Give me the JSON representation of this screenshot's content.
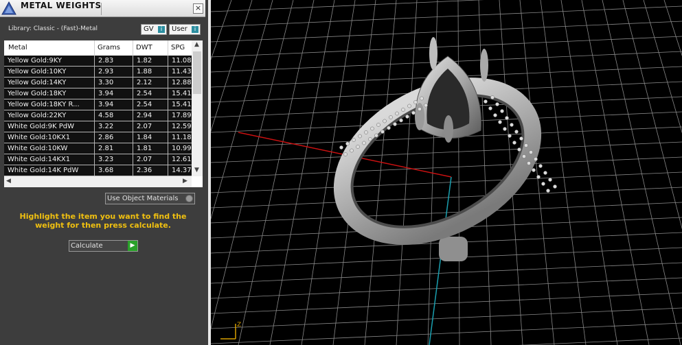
{
  "panel": {
    "title": "METAL WEIGHTS",
    "close_label": "×",
    "library_label": "Library: Classic - (Fast)-Metal",
    "gv_label": "GV",
    "user_label": "User",
    "use_object_materials_label": "Use Object Materials",
    "hint_text": "Highlight the item you want to find the weight for then press calculate.",
    "calculate_label": "Calculate"
  },
  "table": {
    "headers": [
      "Metal",
      "Grams",
      "DWT",
      "SPG"
    ],
    "rows": [
      [
        "Yellow Gold:9KY",
        "2.83",
        "1.82",
        "11.08"
      ],
      [
        "Yellow Gold:10KY",
        "2.93",
        "1.88",
        "11.43"
      ],
      [
        "Yellow Gold:14KY",
        "3.30",
        "2.12",
        "12.88"
      ],
      [
        "Yellow Gold:18KY",
        "3.94",
        "2.54",
        "15.41"
      ],
      [
        "Yellow Gold:18KY R...",
        "3.94",
        "2.54",
        "15.41"
      ],
      [
        "Yellow Gold:22KY",
        "4.58",
        "2.94",
        "17.89"
      ],
      [
        "White Gold:9K PdW",
        "3.22",
        "2.07",
        "12.59"
      ],
      [
        "White Gold:10KX1",
        "2.86",
        "1.84",
        "11.18"
      ],
      [
        "White Gold:10KW",
        "2.81",
        "1.81",
        "10.99"
      ],
      [
        "White Gold:14KX1",
        "3.23",
        "2.07",
        "12.61"
      ],
      [
        "White Gold:14K PdW",
        "3.68",
        "2.36",
        "14.37"
      ]
    ]
  },
  "viewport": {
    "axis_label": "Z",
    "colors": {
      "grid": "#8a8a8a",
      "x_axis": "#cc1111",
      "y_axis": "#1aa0b0",
      "ring": "#c6c6c6"
    }
  }
}
